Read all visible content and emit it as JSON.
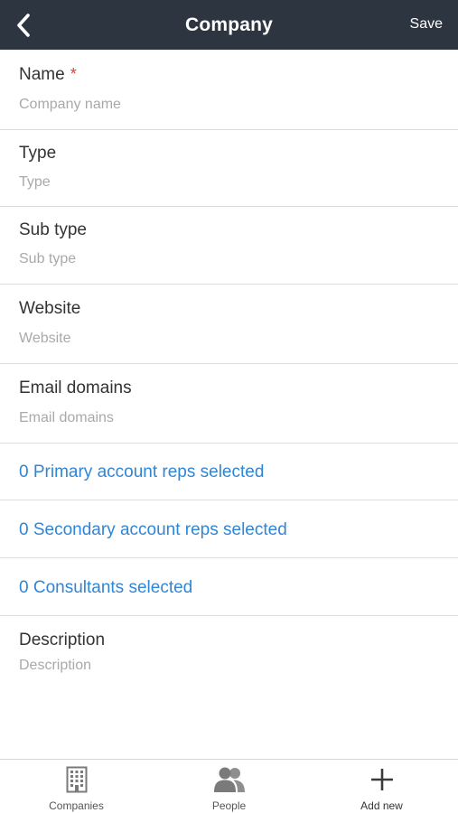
{
  "header": {
    "title": "Company",
    "save_label": "Save"
  },
  "fields": {
    "name": {
      "label": "Name",
      "required_mark": "*",
      "placeholder": "Company name",
      "value": ""
    },
    "type": {
      "label": "Type",
      "placeholder": "Type",
      "value": ""
    },
    "sub_type": {
      "label": "Sub type",
      "placeholder": "Sub type",
      "value": ""
    },
    "website": {
      "label": "Website",
      "placeholder": "Website",
      "value": ""
    },
    "email_domains": {
      "label": "Email domains",
      "placeholder": "Email domains",
      "value": ""
    },
    "description": {
      "label": "Description",
      "placeholder": "Description",
      "value": ""
    }
  },
  "selections": {
    "primary_reps": "0 Primary account reps selected",
    "secondary_reps": "0 Secondary account reps selected",
    "consultants": "0 Consultants selected"
  },
  "tabbar": {
    "companies": {
      "label": "Companies",
      "icon": "building-icon"
    },
    "people": {
      "label": "People",
      "icon": "people-icon"
    },
    "add_new": {
      "label": "Add new",
      "icon": "plus-icon"
    }
  },
  "colors": {
    "header_bg": "#2d3640",
    "link": "#2f86d6",
    "required": "#e03a3a"
  }
}
